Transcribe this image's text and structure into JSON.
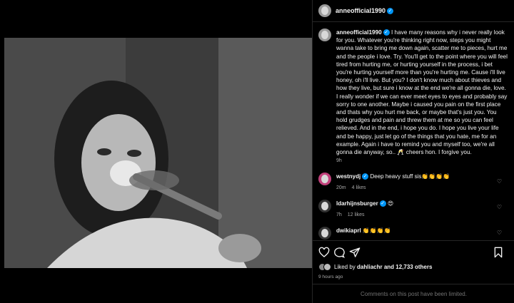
{
  "post": {
    "username": "anneofficial1990",
    "caption": "I have many reasons why i never really look for you. Whatever you're thinking right now, steps you might wanna take to bring me down again, scatter me to pieces, hurt me and the people i love. Try. You'll get to the point where you will feel tired from hurting me, or hurting yourself in the process, i bet you're hurting yourself more than you're hurting me. Cause i'll live honey, oh i'll live. But you? I don't know much about thieves and how they live, but sure i know at the end we're all gonna die, love. I really wonder if we can ever meet eyes to eyes and probably say sorry to one another. Maybe i caused you pain on the first place and thats why you hurt me back, or maybe that's just you. You hold grudges and pain and threw them at me so you can feel relieved. And in the end, i hope you do. I hope you live your life and be happy, just let go of the things that you hate, me for an example. Again i have to remind you and myself too, we're all gonna die anyway, so.. 🥂 cheers hon. I forgive you.",
    "caption_time": "9h"
  },
  "comments": [
    {
      "user": "westnydj",
      "text": "Deep heavy stuff sis👏👏👏👏",
      "time": "20m",
      "likes": "4 likes"
    },
    {
      "user": "ldarhijnsburger",
      "text": "😍",
      "time": "7h",
      "likes": "12 likes"
    },
    {
      "user": "dwikiaprl",
      "text": "👏👏👏👏",
      "time": "",
      "likes": ""
    }
  ],
  "footer": {
    "liked_by_prefix": "Liked by",
    "liked_by_user": "dahliachr",
    "liked_by_suffix": "and 12,733 others",
    "time_ago": "9 hours ago",
    "comments_limited": "Comments on this post have been limited."
  },
  "icons": [
    "heart-icon",
    "comment-icon",
    "share-icon",
    "bookmark-icon",
    "verified-badge-icon"
  ],
  "colors": {
    "verified": "#0095f6",
    "background": "#000000",
    "muted": "#a8a8a8"
  }
}
